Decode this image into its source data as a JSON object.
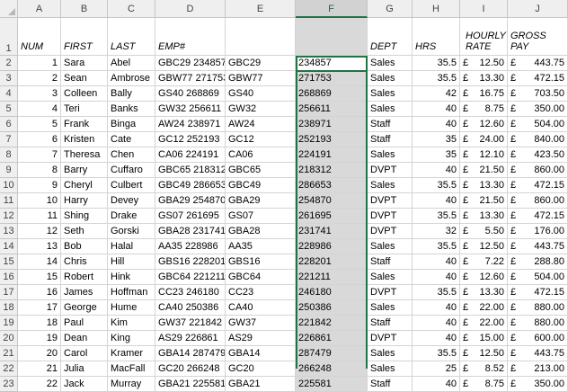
{
  "columns": [
    "A",
    "B",
    "C",
    "D",
    "E",
    "F",
    "G",
    "H",
    "I",
    "J"
  ],
  "selected_column": "F",
  "header_row": {
    "row_num": "1",
    "num": "NUM",
    "first": "FIRST",
    "last": "LAST",
    "emp": "EMP#",
    "dept": "DEPT",
    "hrs": "HRS",
    "rate_line1": "HOURLY",
    "rate_line2": "RATE",
    "gross_line1": "GROSS",
    "gross_line2": "PAY"
  },
  "currency_symbol": "£",
  "rows": [
    {
      "r": "2",
      "num": "1",
      "first": "Sara",
      "last": "Abel",
      "emp": "GBC29 234857",
      "code": "GBC29",
      "f": "234857",
      "dept": "Sales",
      "hrs": "35.5",
      "rate": "12.50",
      "gross": "443.75"
    },
    {
      "r": "3",
      "num": "2",
      "first": "Sean",
      "last": "Ambrose",
      "emp": "GBW77 271753",
      "code": "GBW77",
      "f": "271753",
      "dept": "Sales",
      "hrs": "35.5",
      "rate": "13.30",
      "gross": "472.15"
    },
    {
      "r": "4",
      "num": "3",
      "first": "Colleen",
      "last": "Bally",
      "emp": "GS40 268869",
      "code": "GS40",
      "f": "268869",
      "dept": "Sales",
      "hrs": "42",
      "rate": "16.75",
      "gross": "703.50"
    },
    {
      "r": "5",
      "num": "4",
      "first": "Teri",
      "last": "Banks",
      "emp": "GW32 256611",
      "code": "GW32",
      "f": "256611",
      "dept": "Sales",
      "hrs": "40",
      "rate": "8.75",
      "gross": "350.00"
    },
    {
      "r": "6",
      "num": "5",
      "first": "Frank",
      "last": "Binga",
      "emp": "AW24 238971",
      "code": "AW24",
      "f": "238971",
      "dept": "Staff",
      "hrs": "40",
      "rate": "12.60",
      "gross": "504.00"
    },
    {
      "r": "7",
      "num": "6",
      "first": "Kristen",
      "last": "Cate",
      "emp": "GC12 252193",
      "code": "GC12",
      "f": "252193",
      "dept": "Staff",
      "hrs": "35",
      "rate": "24.00",
      "gross": "840.00"
    },
    {
      "r": "8",
      "num": "7",
      "first": "Theresa",
      "last": "Chen",
      "emp": "CA06 224191",
      "code": "CA06",
      "f": "224191",
      "dept": "Sales",
      "hrs": "35",
      "rate": "12.10",
      "gross": "423.50"
    },
    {
      "r": "9",
      "num": "8",
      "first": "Barry",
      "last": "Cuffaro",
      "emp": "GBC65 218312",
      "code": "GBC65",
      "f": "218312",
      "dept": "DVPT",
      "hrs": "40",
      "rate": "21.50",
      "gross": "860.00"
    },
    {
      "r": "10",
      "num": "9",
      "first": "Cheryl",
      "last": "Culbert",
      "emp": "GBC49 286653",
      "code": "GBC49",
      "f": "286653",
      "dept": "Sales",
      "hrs": "35.5",
      "rate": "13.30",
      "gross": "472.15"
    },
    {
      "r": "11",
      "num": "10",
      "first": "Harry",
      "last": "Devey",
      "emp": "GBA29 254870",
      "code": "GBA29",
      "f": "254870",
      "dept": "DVPT",
      "hrs": "40",
      "rate": "21.50",
      "gross": "860.00"
    },
    {
      "r": "12",
      "num": "11",
      "first": "Shing",
      "last": "Drake",
      "emp": "GS07 261695",
      "code": "GS07",
      "f": "261695",
      "dept": "DVPT",
      "hrs": "35.5",
      "rate": "13.30",
      "gross": "472.15"
    },
    {
      "r": "13",
      "num": "12",
      "first": "Seth",
      "last": "Gorski",
      "emp": "GBA28 231741",
      "code": "GBA28",
      "f": "231741",
      "dept": "DVPT",
      "hrs": "32",
      "rate": "5.50",
      "gross": "176.00"
    },
    {
      "r": "14",
      "num": "13",
      "first": "Bob",
      "last": "Halal",
      "emp": "AA35 228986",
      "code": "AA35",
      "f": "228986",
      "dept": "Sales",
      "hrs": "35.5",
      "rate": "12.50",
      "gross": "443.75"
    },
    {
      "r": "15",
      "num": "14",
      "first": "Chris",
      "last": "Hill",
      "emp": "GBS16 228201",
      "code": "GBS16",
      "f": "228201",
      "dept": "Staff",
      "hrs": "40",
      "rate": "7.22",
      "gross": "288.80"
    },
    {
      "r": "16",
      "num": "15",
      "first": "Robert",
      "last": "Hink",
      "emp": "GBC64 221211",
      "code": "GBC64",
      "f": "221211",
      "dept": "Sales",
      "hrs": "40",
      "rate": "12.60",
      "gross": "504.00"
    },
    {
      "r": "17",
      "num": "16",
      "first": "James",
      "last": "Hoffman",
      "emp": "CC23 246180",
      "code": "CC23",
      "f": "246180",
      "dept": "DVPT",
      "hrs": "35.5",
      "rate": "13.30",
      "gross": "472.15"
    },
    {
      "r": "18",
      "num": "17",
      "first": "George",
      "last": "Hume",
      "emp": "CA40 250386",
      "code": "CA40",
      "f": "250386",
      "dept": "Sales",
      "hrs": "40",
      "rate": "22.00",
      "gross": "880.00"
    },
    {
      "r": "19",
      "num": "18",
      "first": "Paul",
      "last": "Kim",
      "emp": "GW37 221842",
      "code": "GW37",
      "f": "221842",
      "dept": "Staff",
      "hrs": "40",
      "rate": "22.00",
      "gross": "880.00"
    },
    {
      "r": "20",
      "num": "19",
      "first": "Dean",
      "last": "King",
      "emp": "AS29 226861",
      "code": "AS29",
      "f": "226861",
      "dept": "DVPT",
      "hrs": "40",
      "rate": "15.00",
      "gross": "600.00"
    },
    {
      "r": "21",
      "num": "20",
      "first": "Carol",
      "last": "Kramer",
      "emp": "GBA14 287479",
      "code": "GBA14",
      "f": "287479",
      "dept": "Sales",
      "hrs": "35.5",
      "rate": "12.50",
      "gross": "443.75"
    },
    {
      "r": "22",
      "num": "21",
      "first": "Julia",
      "last": "MacFall",
      "emp": "GC20 266248",
      "code": "GC20",
      "f": "266248",
      "dept": "Sales",
      "hrs": "25",
      "rate": "8.52",
      "gross": "213.00"
    },
    {
      "r": "23",
      "num": "22",
      "first": "Jack",
      "last": "Murray",
      "emp": "GBA21 225581",
      "code": "GBA21",
      "f": "225581",
      "dept": "Staff",
      "hrs": "40",
      "rate": "8.75",
      "gross": "350.00"
    }
  ]
}
